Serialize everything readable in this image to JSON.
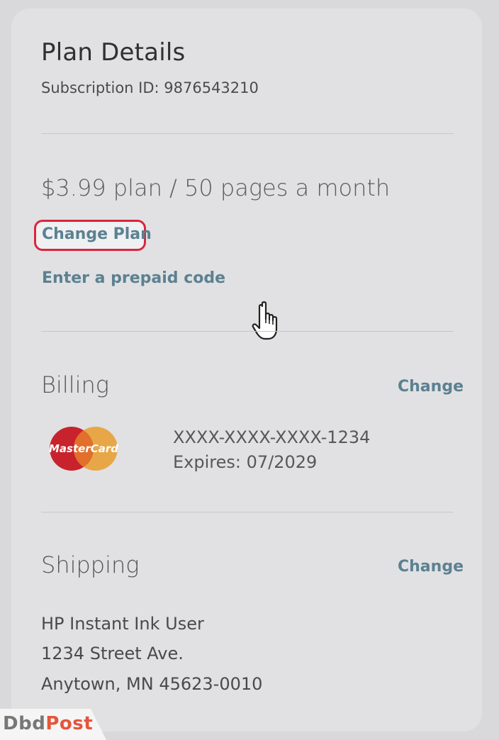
{
  "plan_details": {
    "title": "Plan Details",
    "subscription_id": "Subscription ID: 9876543210",
    "plan_text": "$3.99 plan / 50 pages a month",
    "change_plan_link": "Change Plan",
    "prepaid_code_link": "Enter a prepaid code"
  },
  "billing": {
    "title": "Billing",
    "change_link": "Change",
    "card_brand_icon": "mastercard-logo",
    "card_brand_text": "MasterCard",
    "card_number": "XXXX-XXXX-XXXX-1234",
    "expires": "Expires: 07/2029"
  },
  "shipping": {
    "title": "Shipping",
    "change_link": "Change",
    "address_lines": [
      "HP Instant Ink User",
      "1234 Street Ave.",
      "Anytown, MN 45623-0010"
    ]
  },
  "cursor_icon": "hand-pointer-icon",
  "watermark": {
    "part1": "Dbd",
    "part2": "Post"
  },
  "colors": {
    "link": "#5c8191",
    "highlight": "#d9263f",
    "card_bg": "#e1e1e3",
    "mastercard_red": "#c8232c",
    "mastercard_orange": "#e8a23a"
  }
}
